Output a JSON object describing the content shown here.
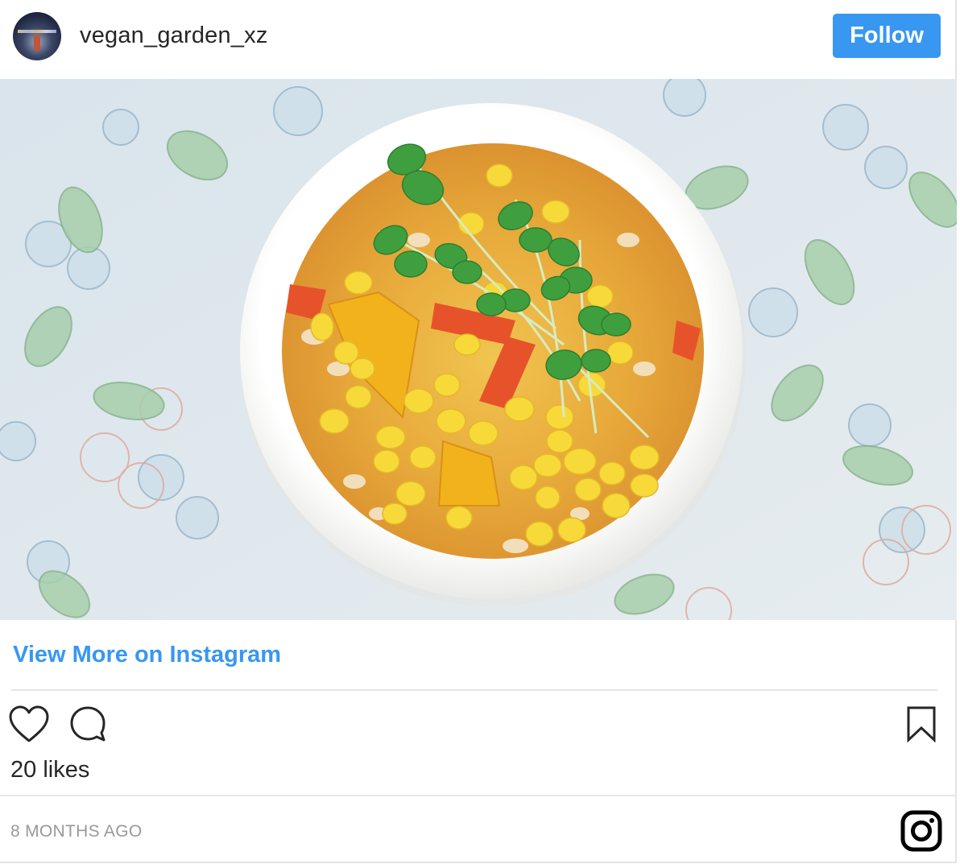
{
  "header": {
    "username": "vegan_garden_xz",
    "follow_label": "Follow"
  },
  "post": {
    "image_icon": "food-photo",
    "view_more_label": "View More on Instagram",
    "likes_text": "20 likes",
    "timestamp": "8 MONTHS AGO"
  },
  "icons": {
    "like": "heart-icon",
    "comment": "comment-icon",
    "save": "bookmark-icon",
    "brand": "instagram-icon"
  },
  "colors": {
    "accent": "#3897f0",
    "text": "#262626",
    "muted": "#999999"
  }
}
